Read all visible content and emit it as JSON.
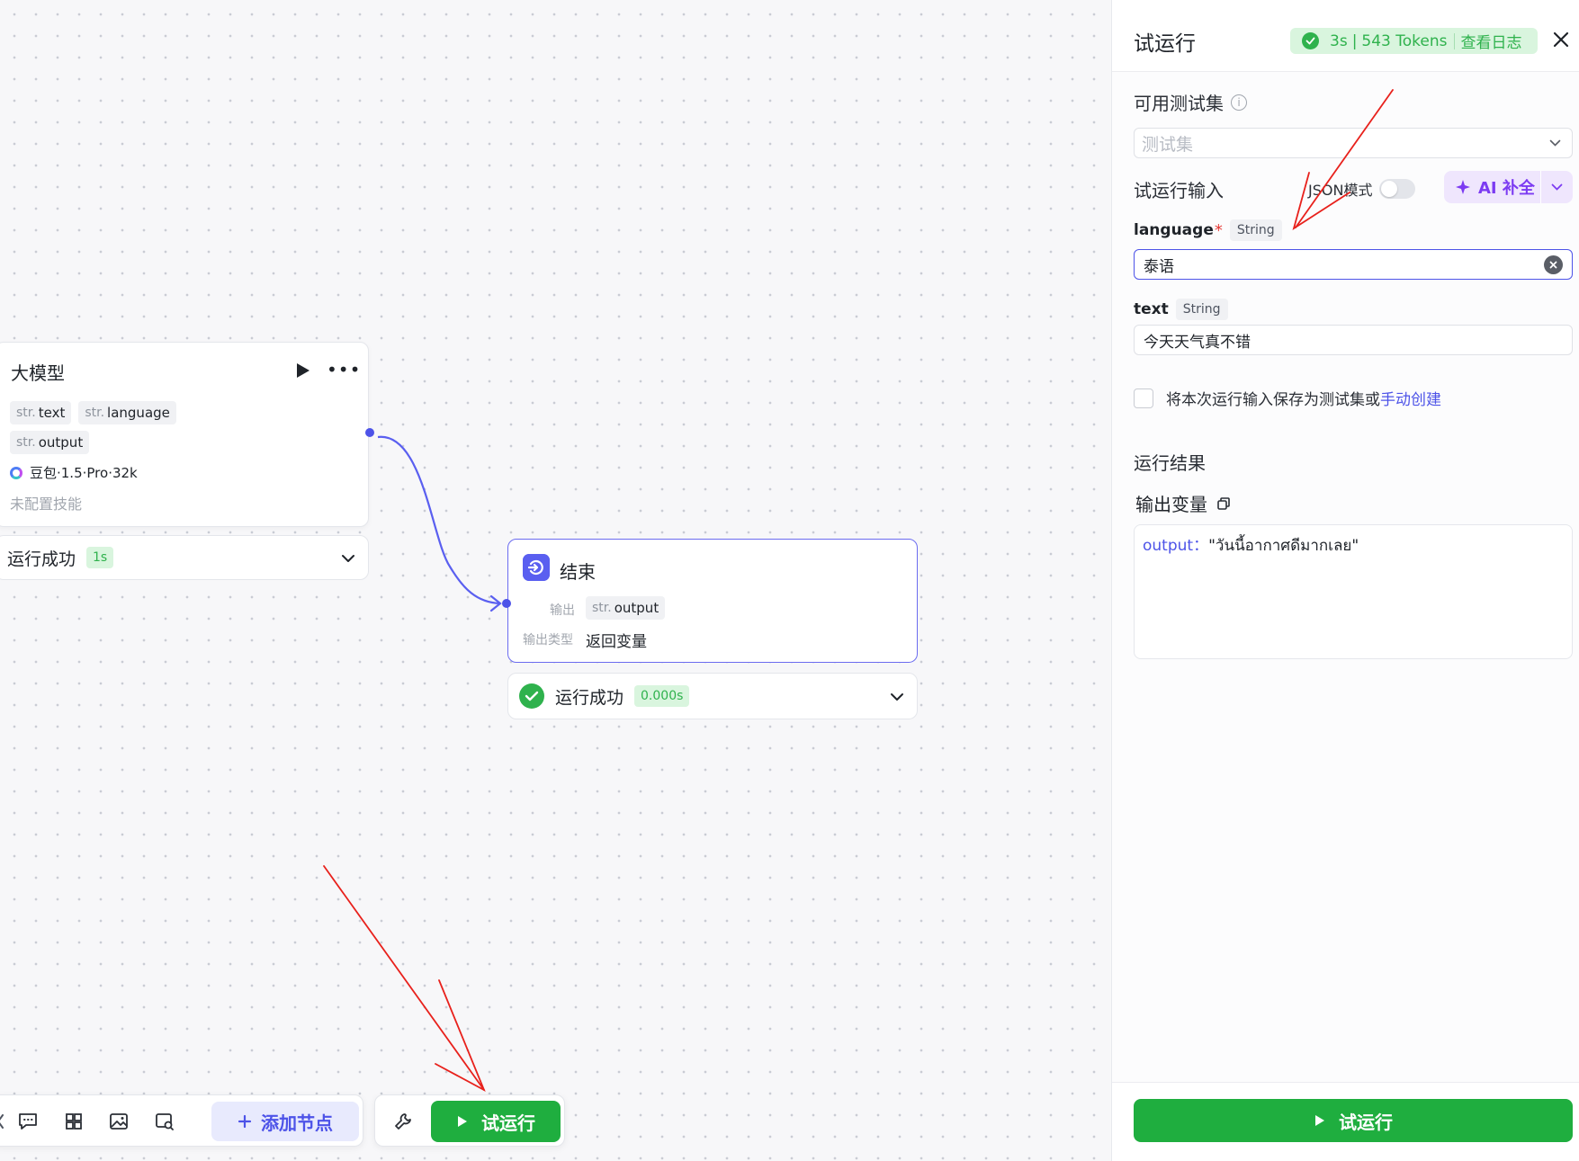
{
  "llm_node": {
    "title": "大模型",
    "inputs": [
      {
        "prefix": "str.",
        "name": "text"
      },
      {
        "prefix": "str.",
        "name": "language"
      }
    ],
    "outputs": [
      {
        "prefix": "str.",
        "name": "output"
      }
    ],
    "model": "豆包·1.5·Pro·32k",
    "skills": "未配置技能",
    "status": {
      "text": "运行成功",
      "duration": "1s"
    }
  },
  "end_node": {
    "title": "结束",
    "output_label": "输出",
    "output_tag": {
      "prefix": "str.",
      "name": "output"
    },
    "output_type_label": "输出类型",
    "output_type_value": "返回变量",
    "status": {
      "text": "运行成功",
      "duration": "0.000s"
    }
  },
  "toolbar": {
    "icons": [
      "comment-icon",
      "layout-icon",
      "image-icon",
      "preview-icon"
    ],
    "add_node_label": "添加节点",
    "trial_run_label": "试运行"
  },
  "panel": {
    "title": "试运行",
    "summary": {
      "time": "3s",
      "tokens": "543 Tokens",
      "view_log": "查看日志"
    },
    "dataset_label": "可用测试集",
    "dataset_placeholder": "测试集",
    "input_label": "试运行输入",
    "json_mode_label": "JSON模式",
    "json_mode_on": false,
    "ai_fill_label": "AI 补全",
    "fields": [
      {
        "name": "language",
        "required": "*",
        "type": "String",
        "value": "泰语"
      },
      {
        "name": "text",
        "type": "String",
        "value": "今天天气真不错"
      }
    ],
    "save_text": "将本次运行输入保存为测试集或",
    "save_link": "手动创建",
    "result_title": "运行结果",
    "output_var_title": "输出变量",
    "result": {
      "key": "output：",
      "value": "\"วันนี้อากาศดีมากเลย\""
    },
    "run_button": "试运行"
  },
  "colors": {
    "accent": "#4d53e8",
    "success": "#1fae3f",
    "success_bg": "#d9f5de",
    "ai_purple": "#7c3bf2",
    "annotation_red": "#e8211c"
  }
}
